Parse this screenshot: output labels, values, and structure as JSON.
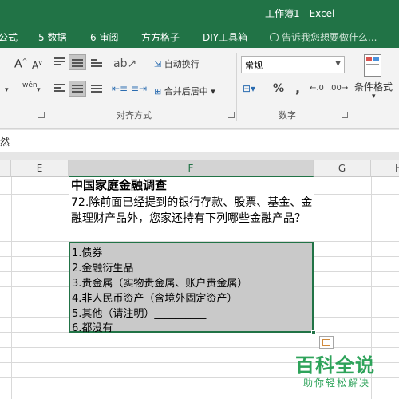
{
  "window": {
    "title": "工作簿1 - Excel"
  },
  "tabs": [
    "公式",
    "5 数据",
    "6 审阅",
    "方方格子",
    "DIY工具箱"
  ],
  "tell_me": "告诉我您想要做什么...",
  "ribbon": {
    "font_grow": "A",
    "font_shrink": "A",
    "phonetic": "wén",
    "wrap_text": "自动换行",
    "merge_center": "合并后居中",
    "number_format": "常规",
    "percent": "%",
    "comma": ",",
    "conditional_format": "条件格式",
    "group_alignment": "对齐方式",
    "group_number": "数字"
  },
  "formula_bar": {
    "text": "然"
  },
  "columns": {
    "e": "E",
    "f": "F",
    "g": "G",
    "h": "H"
  },
  "sheet": {
    "heading": "中国家庭金融调查",
    "question": "72.除前面已经提到的银行存款、股票、基金、金融理财产品外，您家还持有下列哪些金融产品？",
    "options": [
      "1.债券",
      "2.金融衍生品",
      "3.贵金属（实物贵金属、账户贵金属）",
      "4.非人民币资产（含境外固定资产）",
      "5.其他（请注明）__________",
      "6.都没有"
    ]
  },
  "watermark": {
    "title": "百科全说",
    "subtitle": "助你轻松解决"
  },
  "colors": {
    "accent": "#217346",
    "selection": "#c9c9c9",
    "watermark": "#2ea35a"
  }
}
